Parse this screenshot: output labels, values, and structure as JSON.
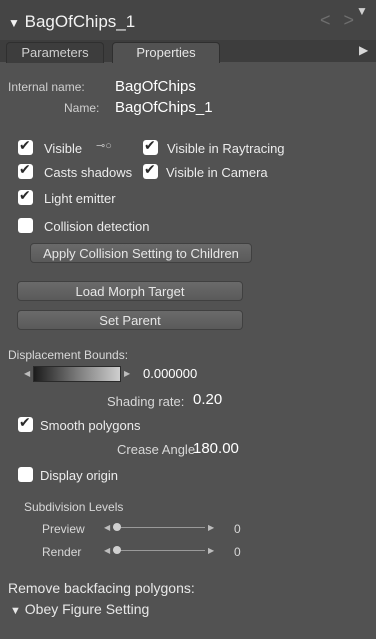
{
  "header": {
    "title": "BagOfChips_1",
    "nav_arrows": "< >"
  },
  "tabs": [
    {
      "label": "Parameters"
    },
    {
      "label": "Properties"
    }
  ],
  "names": {
    "internal_label": "Internal name:",
    "internal_value": "BagOfChips",
    "name_label": "Name:",
    "name_value": "BagOfChips_1"
  },
  "checkboxes": {
    "visible": {
      "label": "Visible",
      "checked": true
    },
    "visible_raytracing": {
      "label": "Visible in Raytracing",
      "checked": true
    },
    "casts_shadows": {
      "label": "Casts shadows",
      "checked": true
    },
    "visible_camera": {
      "label": "Visible in Camera",
      "checked": true
    },
    "light_emitter": {
      "label": "Light emitter",
      "checked": true
    },
    "collision_detection": {
      "label": "Collision detection",
      "checked": false
    },
    "smooth_polygons": {
      "label": "Smooth polygons",
      "checked": true
    },
    "display_origin": {
      "label": "Display origin",
      "checked": false
    }
  },
  "buttons": {
    "apply_collision": "Apply Collision Setting to Children",
    "load_morph": "Load Morph Target",
    "set_parent": "Set Parent"
  },
  "displacement": {
    "label": "Displacement Bounds:",
    "value": "0.000000"
  },
  "shading": {
    "label": "Shading rate:",
    "value": "0.20"
  },
  "crease": {
    "label": "Crease Angle",
    "value": "180.00"
  },
  "subdivision": {
    "title": "Subdivision Levels",
    "preview": {
      "label": "Preview",
      "value": "0"
    },
    "render": {
      "label": "Render",
      "value": "0"
    }
  },
  "backfacing": {
    "label": "Remove backfacing polygons:",
    "option": "Obey Figure Setting"
  },
  "colors": {
    "panel": "#525252",
    "header": "#454545",
    "tabbar": "#3d3d3d"
  }
}
